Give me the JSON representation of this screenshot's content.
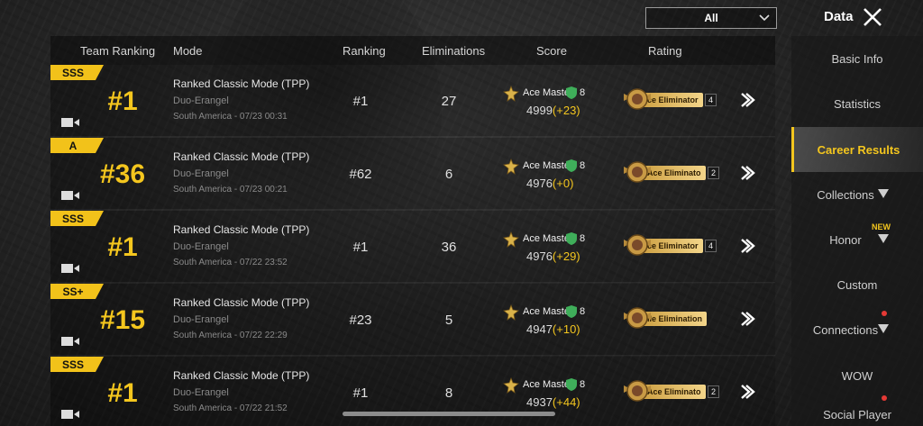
{
  "top_bar": {
    "filter_value": "All",
    "title": "Data"
  },
  "columns": {
    "team_ranking": "Team Ranking",
    "mode": "Mode",
    "ranking": "Ranking",
    "eliminations": "Eliminations",
    "score": "Score",
    "rating": "Rating"
  },
  "rows": [
    {
      "grade": "SSS",
      "team_rank": "#1",
      "mode": "Ranked Classic Mode (TPP)",
      "map": "Duo-Erangel",
      "date": "South America - 07/23 00:31",
      "ranking": "#1",
      "eliminations": "27",
      "tier": "Ace Master",
      "tier_num": "8",
      "score": "4999",
      "delta": "(+23)",
      "rating_text": "ce Eliminator",
      "rating_lvl": "4"
    },
    {
      "grade": "A",
      "team_rank": "#36",
      "mode": "Ranked Classic Mode (TPP)",
      "map": "Duo-Erangel",
      "date": "South America - 07/23 00:21",
      "ranking": "#62",
      "eliminations": "6",
      "tier": "Ace Master",
      "tier_num": "8",
      "score": "4976",
      "delta": "(+0)",
      "rating_text": "Ace Eliminato",
      "rating_lvl": "2"
    },
    {
      "grade": "SSS",
      "team_rank": "#1",
      "mode": "Ranked Classic Mode (TPP)",
      "map": "Duo-Erangel",
      "date": "South America - 07/22 23:52",
      "ranking": "#1",
      "eliminations": "36",
      "tier": "Ace Master",
      "tier_num": "8",
      "score": "4976",
      "delta": "(+29)",
      "rating_text": "ce Eliminator",
      "rating_lvl": "4"
    },
    {
      "grade": "SS+",
      "team_rank": "#15",
      "mode": "Ranked Classic Mode (TPP)",
      "map": "Duo-Erangel",
      "date": "South America - 07/22 22:29",
      "ranking": "#23",
      "eliminations": "5",
      "tier": "Ace Master",
      "tier_num": "8",
      "score": "4947",
      "delta": "(+10)",
      "rating_text": "ile Elimination",
      "rating_lvl": ""
    },
    {
      "grade": "SSS",
      "team_rank": "#1",
      "mode": "Ranked Classic Mode (TPP)",
      "map": "Duo-Erangel",
      "date": "South America - 07/22 21:52",
      "ranking": "#1",
      "eliminations": "8",
      "tier": "Ace Master",
      "tier_num": "8",
      "score": "4937",
      "delta": "(+44)",
      "rating_text": "Ace Eliminato",
      "rating_lvl": "2"
    }
  ],
  "sidebar": {
    "items": [
      {
        "label": "Basic Info"
      },
      {
        "label": "Statistics"
      },
      {
        "label": "Career Results"
      },
      {
        "label": "Collections"
      },
      {
        "label": "Honor"
      },
      {
        "label": "Custom"
      },
      {
        "label": "Connections"
      },
      {
        "label": "WOW"
      },
      {
        "label": "Social Player"
      }
    ],
    "new_badge": "NEW"
  },
  "colors": {
    "accent": "#f4c61e",
    "delta": "#f4c61e",
    "notification": "#e53935"
  }
}
